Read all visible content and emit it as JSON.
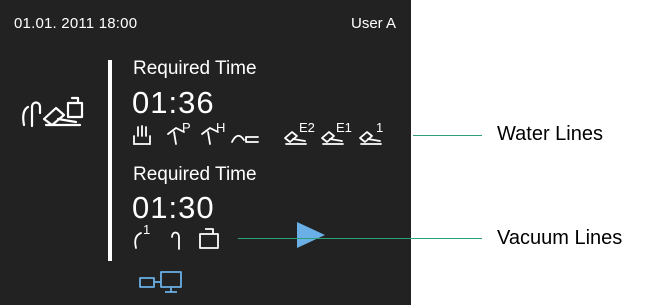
{
  "status_bar": {
    "datetime": "01.01. 2011 18:00",
    "user": "User A"
  },
  "water": {
    "label": "Required Time",
    "time": "01:36"
  },
  "vacuum": {
    "label": "Required Time",
    "time": "01:30"
  },
  "sub_labels": {
    "p": "P",
    "h": "H",
    "e2": "E2",
    "e1": "E1",
    "one": "1"
  },
  "icons": {
    "main": "handpiece-cleaning-icon",
    "water_lines": [
      "spittoon-icon",
      "handpiece-p-icon",
      "handpiece-h-icon",
      "hose-icon",
      "handpiece-e2-icon",
      "handpiece-e1-icon",
      "handpiece-1-icon"
    ],
    "vacuum_lines": [
      "suction-1-icon",
      "suction-2-icon",
      "cup-icon"
    ],
    "start": "play-icon",
    "connection": "usb-connection-icon"
  },
  "callouts": {
    "water_lines": "Water Lines",
    "vacuum_lines": "Vacuum Lines"
  },
  "colors": {
    "screen_bg": "#222222",
    "accent_blue": "#6ab0e6",
    "callout_line": "#2fa07a"
  }
}
